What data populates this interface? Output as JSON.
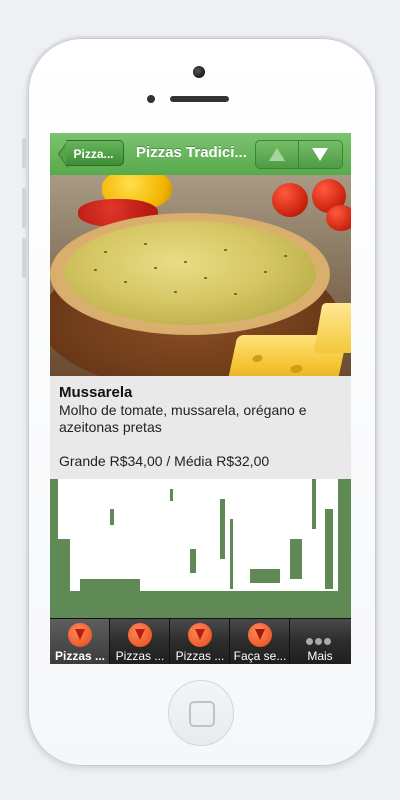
{
  "header": {
    "back_label": "Pizza...",
    "title": "Pizzas Tradici...",
    "nav_up_icon": "triangle-up-icon",
    "nav_down_icon": "triangle-down-icon"
  },
  "item": {
    "name": "Mussarela",
    "ingredients": "Molho de tomate, mussarela, orégano e azeitonas pretas",
    "price": "Grande R$34,00 / Média R$32,00"
  },
  "tabbar": {
    "tabs": [
      {
        "label": "Pizzas ...",
        "icon": "pizza-slice-icon",
        "active": true
      },
      {
        "label": "Pizzas ...",
        "icon": "pizza-slice-icon",
        "active": false
      },
      {
        "label": "Pizzas ...",
        "icon": "pizza-slice-icon",
        "active": false
      },
      {
        "label": "Faça se...",
        "icon": "custom-pizza-icon",
        "active": false
      },
      {
        "label": "Mais",
        "icon": "more-dots-icon",
        "active": false
      }
    ]
  },
  "colors": {
    "header_green": "#58a94c",
    "tabbar_dark": "#2c2c2c",
    "tab_icon_orange": "#ef5a2a",
    "grunge_green": "#5f8a55"
  }
}
